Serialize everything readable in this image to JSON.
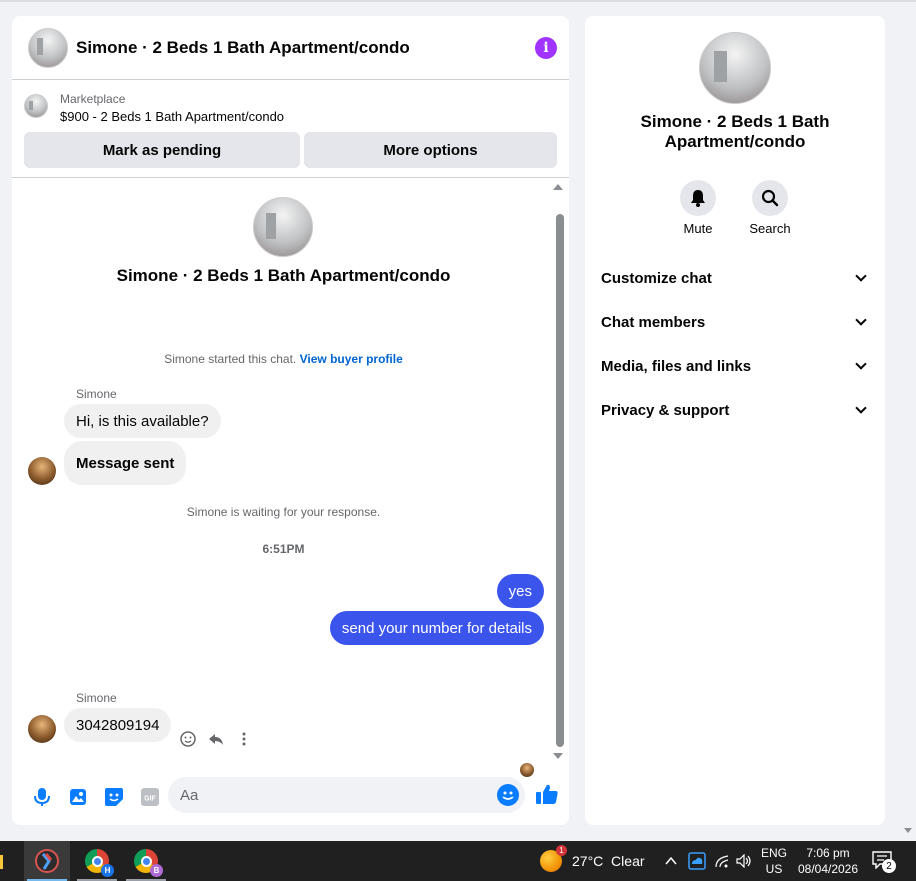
{
  "chat": {
    "header_title": "Simone · 2 Beds 1 Bath Apartment/condo",
    "info_icon": "i",
    "listing": {
      "source": "Marketplace",
      "description": "$900 - 2 Beds 1 Bath Apartment/condo",
      "mark_pending_label": "Mark as pending",
      "more_options_label": "More options"
    },
    "center_title": "Simone · 2 Beds 1 Bath Apartment/condo",
    "started_text": "Simone started this chat.",
    "view_buyer_profile": "View buyer profile",
    "messages": [
      {
        "sender": "Simone",
        "text": "Hi, is this available?"
      },
      {
        "text": "Message sent"
      }
    ],
    "waiting_text": "Simone is waiting for your response.",
    "timestamp": "6:51PM",
    "outgoing": [
      {
        "text": "yes"
      },
      {
        "text": "send your number for details"
      }
    ],
    "last_sender": "Simone",
    "last_message": "3042809194",
    "composer": {
      "placeholder": "Aa",
      "gif_label": "GIF"
    }
  },
  "details": {
    "title": "Simone · 2 Beds 1 Bath Apartment/condo",
    "mute_label": "Mute",
    "search_label": "Search",
    "sections": [
      "Customize chat",
      "Chat members",
      "Media, files and links",
      "Privacy & support"
    ]
  },
  "taskbar": {
    "chrome_profile_1": "H",
    "chrome_profile_2": "B",
    "weather_badge": "1",
    "weather": "27°C  Clear",
    "lang_top": "ENG",
    "lang_bottom": "US",
    "time": "7:06 pm",
    "date": "08/04/2026",
    "notif_count": "2"
  },
  "colors": {
    "accent": "#0a7cff",
    "bubble_out": "#3a54ec",
    "info": "#a033ff",
    "link": "#0064d1"
  }
}
